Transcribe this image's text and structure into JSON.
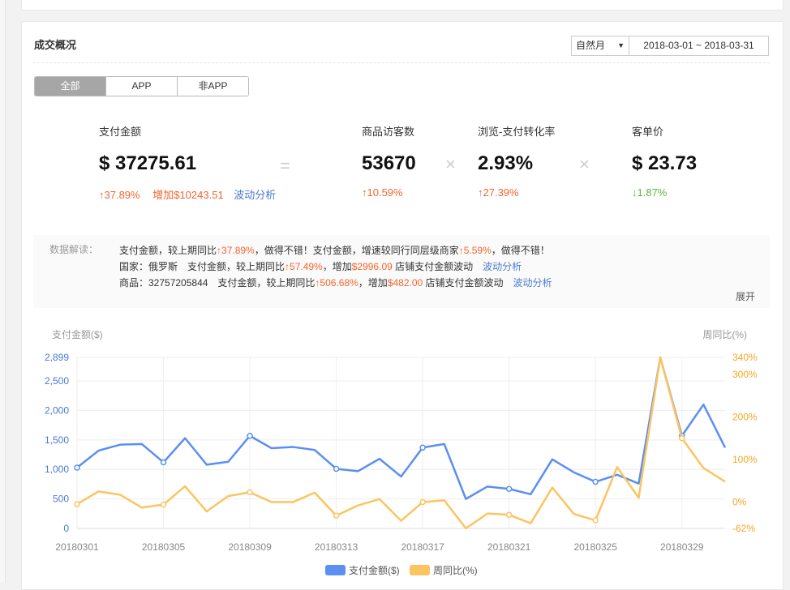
{
  "card": {
    "title": "成交概况",
    "period_select": "自然月",
    "date_range": "2018-03-01 ~ 2018-03-31"
  },
  "tabs": [
    {
      "label": "全部",
      "active": true
    },
    {
      "label": "APP",
      "active": false
    },
    {
      "label": "非APP",
      "active": false
    }
  ],
  "metrics": {
    "payment": {
      "label": "支付金额",
      "value": "$ 37275.61",
      "change": "↑37.89%",
      "increase": "增加$10243.51",
      "link": "波动分析"
    },
    "visitors": {
      "label": "商品访客数",
      "value": "53670",
      "change": "↑10.59%"
    },
    "conversion": {
      "label": "浏览-支付转化率",
      "value": "2.93%",
      "change": "↑27.39%"
    },
    "avg_order": {
      "label": "客单价",
      "value": "$ 23.73",
      "change": "↓1.87%"
    }
  },
  "operators": {
    "equals": "=",
    "times": "×"
  },
  "interpretation": {
    "label": "数据解读：",
    "line1": {
      "t1": "支付金额，较上期同比",
      "v1": "↑37.89%",
      "t2": "，做得不错！支付金额，增速较同行同层级商家",
      "v2": "↑5.59%",
      "t3": "，做得不错！"
    },
    "line2": {
      "t1": "国家：俄罗斯　支付金额，较上期同比",
      "v1": "↑57.49%",
      "t2": "，增加",
      "v2": "$2996.09",
      "t3": " 店铺支付金额波动",
      "link": "波动分析"
    },
    "line3": {
      "t1": "商品：32757205844　支付金额，较上期同比",
      "v1": "↑506.68%",
      "t2": "，增加",
      "v2": "$482.00",
      "t3": " 店铺支付金额波动",
      "link": "波动分析"
    },
    "expand": "展开"
  },
  "chart_data": {
    "type": "line",
    "x": [
      "20180301",
      "20180302",
      "20180303",
      "20180304",
      "20180305",
      "20180306",
      "20180307",
      "20180308",
      "20180309",
      "20180310",
      "20180311",
      "20180312",
      "20180313",
      "20180314",
      "20180315",
      "20180316",
      "20180317",
      "20180318",
      "20180319",
      "20180320",
      "20180321",
      "20180322",
      "20180323",
      "20180324",
      "20180325",
      "20180326",
      "20180327",
      "20180328",
      "20180329",
      "20180330",
      "20180331"
    ],
    "x_tick_labels": [
      "20180301",
      "20180305",
      "20180309",
      "20180313",
      "20180317",
      "20180321",
      "20180325",
      "20180329"
    ],
    "ylabel_left": "支付金额($)",
    "ylabel_right": "周同比(%)",
    "ylim_left": [
      0,
      2899
    ],
    "ylim_right": [
      -62,
      340
    ],
    "y_ticks_left": [
      0,
      500,
      1000,
      1500,
      2000,
      2500,
      2899
    ],
    "y_ticks_left_labels": [
      "0",
      "500",
      "1,000",
      "1,500",
      "2,000",
      "2,500",
      "2,899"
    ],
    "y_ticks_right": [
      -62,
      0,
      100,
      200,
      300,
      340
    ],
    "y_ticks_right_labels": [
      "-62%",
      "0%",
      "100%",
      "200%",
      "300%",
      "340%"
    ],
    "grid": true,
    "legend": "bottom-center",
    "series": [
      {
        "name": "支付金额($)",
        "axis": "left",
        "color": "#5b8ff0",
        "values": [
          1030,
          1320,
          1420,
          1430,
          1120,
          1530,
          1080,
          1130,
          1570,
          1360,
          1380,
          1330,
          1010,
          970,
          1180,
          880,
          1370,
          1430,
          500,
          710,
          670,
          580,
          1170,
          950,
          790,
          910,
          760,
          2899,
          1570,
          2100,
          1370
        ],
        "markers": [
          0,
          4,
          8,
          12,
          16,
          20,
          24,
          28
        ]
      },
      {
        "name": "周同比(%)",
        "axis": "right",
        "color": "#fcc460",
        "values": [
          -5,
          25,
          17,
          -13,
          -6,
          37,
          -22,
          14,
          23,
          0,
          0,
          22,
          -32,
          -8,
          7,
          -44,
          0,
          4,
          -62,
          -27,
          -30,
          -50,
          34,
          -28,
          -43,
          82,
          10,
          340,
          150,
          80,
          48
        ],
        "markers": [
          0,
          4,
          8,
          12,
          16,
          20,
          24,
          28
        ]
      }
    ]
  }
}
